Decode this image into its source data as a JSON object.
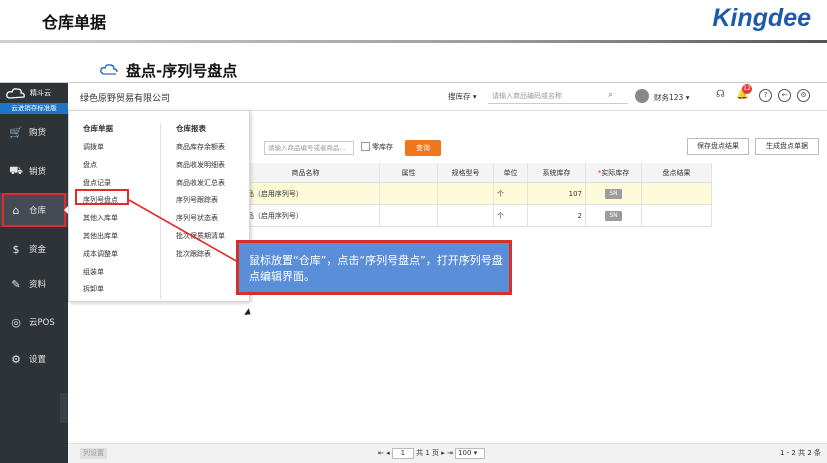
{
  "slide": {
    "title": "仓库单据",
    "logo": "Kingdee",
    "subtitle": "盘点-序列号盘点"
  },
  "sidebar": {
    "brand_name": "精斗云",
    "brand_sub": "云进销存标准版",
    "items": [
      {
        "label": "购货",
        "icon": "cart-icon"
      },
      {
        "label": "销货",
        "icon": "truck-icon"
      },
      {
        "label": "仓库",
        "icon": "home-icon"
      },
      {
        "label": "资金",
        "icon": "money-icon"
      },
      {
        "label": "资料",
        "icon": "pen-icon"
      },
      {
        "label": "云POS",
        "icon": "pos-icon"
      },
      {
        "label": "设置",
        "icon": "gear-icon"
      }
    ]
  },
  "topbar": {
    "company": "绿色原野贸易有限公司",
    "stock_dropdown": "搜库存",
    "search_placeholder": "请输入商品编码或名称",
    "user": "财务123",
    "badge_count": "12"
  },
  "toolbar": {
    "filter_placeholder": "请输入商品编号或者商品...",
    "zero_stock_label": "零库存",
    "query_label": "查询",
    "save_label": "保存盘点结果",
    "generate_label": "生成盘点单据"
  },
  "table": {
    "columns": [
      "商品名称",
      "属性",
      "规格型号",
      "单位",
      "系统库存",
      "实际库存",
      "盘点结果"
    ],
    "rows": [
      {
        "name": "C商品（启用序列号）",
        "attr": "",
        "spec": "",
        "unit": "个",
        "sys_stock": "107",
        "actual": "SN",
        "result": ""
      },
      {
        "name": "C商品（启用序列号）",
        "attr": "",
        "spec": "",
        "unit": "个",
        "sys_stock": "2",
        "actual": "SN",
        "result": ""
      }
    ]
  },
  "menu": {
    "left_head": "仓库单据",
    "left_items": [
      "调拨单",
      "盘点",
      "盘点记录",
      "序列号盘点",
      "其他入库单",
      "其他出库单",
      "成本调整单",
      "组装单",
      "拆卸单"
    ],
    "right_head": "仓库报表",
    "right_items": [
      "商品库存余额表",
      "商品收发明细表",
      "商品收发汇总表",
      "序列号跟踪表",
      "序列号状态表",
      "批次保质期清单",
      "批次跟踪表"
    ]
  },
  "callout": {
    "text": "鼠标放置“仓库”，点击“序列号盘点”，打开序列号盘点编辑界面。"
  },
  "bottombar": {
    "left_label": "列设置",
    "page_input": "1",
    "page_total": "共 1 页",
    "page_size": "100",
    "range": "1 - 2  共 2 条"
  },
  "colors": {
    "accent": "#f0761d",
    "highlight_red": "#e52a2a",
    "callout_blue": "#5b8ed8",
    "sidebar_bg": "#2e3338",
    "brand_blue": "#1e5aa8"
  }
}
